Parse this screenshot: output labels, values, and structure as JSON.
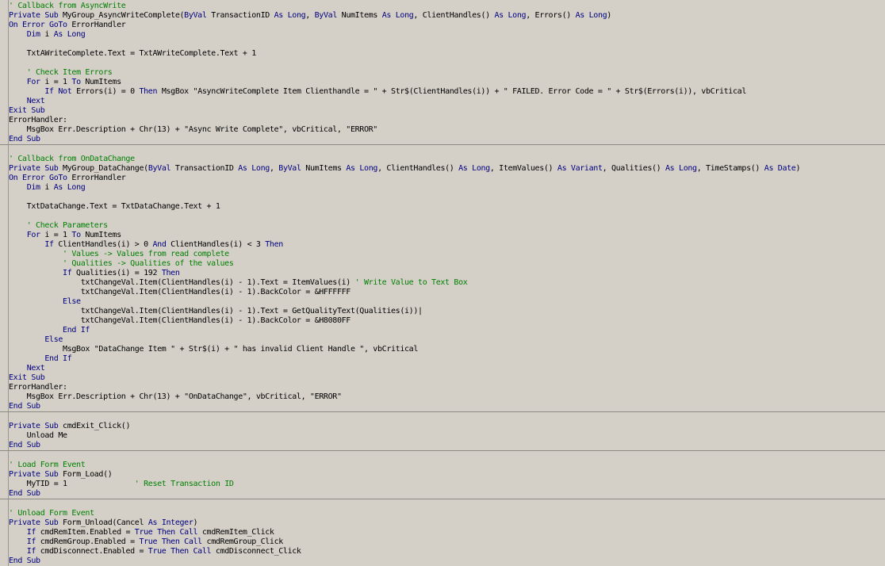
{
  "colors": {
    "keyword": "#00007f",
    "comment": "#007f00",
    "text": "#000000",
    "background": "#d4d0c8"
  },
  "lines": [
    [
      [
        "c",
        "' Callback from AsyncWrite"
      ]
    ],
    [
      [
        "k",
        "Private Sub"
      ],
      [
        "t",
        " MyGroup_AsyncWriteComplete("
      ],
      [
        "k",
        "ByVal"
      ],
      [
        "t",
        " TransactionID "
      ],
      [
        "k",
        "As Long"
      ],
      [
        "t",
        ", "
      ],
      [
        "k",
        "ByVal"
      ],
      [
        "t",
        " NumItems "
      ],
      [
        "k",
        "As Long"
      ],
      [
        "t",
        ", ClientHandles() "
      ],
      [
        "k",
        "As Long"
      ],
      [
        "t",
        ", Errors() "
      ],
      [
        "k",
        "As Long"
      ],
      [
        "t",
        ")"
      ]
    ],
    [
      [
        "k",
        "On Error GoTo"
      ],
      [
        "t",
        " ErrorHandler"
      ]
    ],
    [
      [
        "t",
        "    "
      ],
      [
        "k",
        "Dim"
      ],
      [
        "t",
        " i "
      ],
      [
        "k",
        "As Long"
      ]
    ],
    [],
    [
      [
        "t",
        "    TxtAWriteComplete.Text = TxtAWriteComplete.Text + 1"
      ]
    ],
    [],
    [
      [
        "t",
        "    "
      ],
      [
        "c",
        "' Check Item Errors"
      ]
    ],
    [
      [
        "t",
        "    "
      ],
      [
        "k",
        "For"
      ],
      [
        "t",
        " i = 1 "
      ],
      [
        "k",
        "To"
      ],
      [
        "t",
        " NumItems"
      ]
    ],
    [
      [
        "t",
        "        "
      ],
      [
        "k",
        "If Not"
      ],
      [
        "t",
        " Errors(i) = 0 "
      ],
      [
        "k",
        "Then"
      ],
      [
        "t",
        " MsgBox \"AsyncWriteComplete Item Clienthandle = \" + Str$(ClientHandles(i)) + \" FAILED. Error Code = \" + Str$(Errors(i)), vbCritical"
      ]
    ],
    [
      [
        "t",
        "    "
      ],
      [
        "k",
        "Next"
      ]
    ],
    [
      [
        "k",
        "Exit Sub"
      ]
    ],
    [
      [
        "t",
        "ErrorHandler:"
      ]
    ],
    [
      [
        "t",
        "    MsgBox Err.Description + Chr(13) + \"Async Write Complete\", vbCritical, \"ERROR\""
      ]
    ],
    [
      [
        "k",
        "End Sub"
      ]
    ],
    "sep",
    [],
    [
      [
        "c",
        "' Callback from OnDataChange"
      ]
    ],
    [
      [
        "k",
        "Private Sub"
      ],
      [
        "t",
        " MyGroup_DataChange("
      ],
      [
        "k",
        "ByVal"
      ],
      [
        "t",
        " TransactionID "
      ],
      [
        "k",
        "As Long"
      ],
      [
        "t",
        ", "
      ],
      [
        "k",
        "ByVal"
      ],
      [
        "t",
        " NumItems "
      ],
      [
        "k",
        "As Long"
      ],
      [
        "t",
        ", ClientHandles() "
      ],
      [
        "k",
        "As Long"
      ],
      [
        "t",
        ", ItemValues() "
      ],
      [
        "k",
        "As Variant"
      ],
      [
        "t",
        ", Qualities() "
      ],
      [
        "k",
        "As Long"
      ],
      [
        "t",
        ", TimeStamps() "
      ],
      [
        "k",
        "As Date"
      ],
      [
        "t",
        ")"
      ]
    ],
    [
      [
        "k",
        "On Error GoTo"
      ],
      [
        "t",
        " ErrorHandler"
      ]
    ],
    [
      [
        "t",
        "    "
      ],
      [
        "k",
        "Dim"
      ],
      [
        "t",
        " i "
      ],
      [
        "k",
        "As Long"
      ]
    ],
    [],
    [
      [
        "t",
        "    TxtDataChange.Text = TxtDataChange.Text + 1"
      ]
    ],
    [],
    [
      [
        "t",
        "    "
      ],
      [
        "c",
        "' Check Parameters"
      ]
    ],
    [
      [
        "t",
        "    "
      ],
      [
        "k",
        "For"
      ],
      [
        "t",
        " i = 1 "
      ],
      [
        "k",
        "To"
      ],
      [
        "t",
        " NumItems"
      ]
    ],
    [
      [
        "t",
        "        "
      ],
      [
        "k",
        "If"
      ],
      [
        "t",
        " ClientHandles(i) > 0 "
      ],
      [
        "k",
        "And"
      ],
      [
        "t",
        " ClientHandles(i) < 3 "
      ],
      [
        "k",
        "Then"
      ]
    ],
    [
      [
        "t",
        "            "
      ],
      [
        "c",
        "' Values -> Values from read complete"
      ]
    ],
    [
      [
        "t",
        "            "
      ],
      [
        "c",
        "' Qualities -> Qualities of the values"
      ]
    ],
    [
      [
        "t",
        "            "
      ],
      [
        "k",
        "If"
      ],
      [
        "t",
        " Qualities(i) = 192 "
      ],
      [
        "k",
        "Then"
      ]
    ],
    [
      [
        "t",
        "                txtChangeVal.Item(ClientHandles(i) - 1).Text = ItemValues(i) "
      ],
      [
        "c",
        "' Write Value to Text Box"
      ]
    ],
    [
      [
        "t",
        "                txtChangeVal.Item(ClientHandles(i) - 1).BackColor = &HFFFFFF"
      ]
    ],
    [
      [
        "t",
        "            "
      ],
      [
        "k",
        "Else"
      ]
    ],
    [
      [
        "t",
        "                txtChangeVal.Item(ClientHandles(i) - 1).Text = GetQualityText(Qualities(i))|"
      ]
    ],
    [
      [
        "t",
        "                txtChangeVal.Item(ClientHandles(i) - 1).BackColor = &H8080FF"
      ]
    ],
    [
      [
        "t",
        "            "
      ],
      [
        "k",
        "End If"
      ]
    ],
    [
      [
        "t",
        "        "
      ],
      [
        "k",
        "Else"
      ]
    ],
    [
      [
        "t",
        "            MsgBox \"DataChange Item \" + Str$(i) + \" has invalid Client Handle \", vbCritical"
      ]
    ],
    [
      [
        "t",
        "        "
      ],
      [
        "k",
        "End If"
      ]
    ],
    [
      [
        "t",
        "    "
      ],
      [
        "k",
        "Next"
      ]
    ],
    [
      [
        "k",
        "Exit Sub"
      ]
    ],
    [
      [
        "t",
        "ErrorHandler:"
      ]
    ],
    [
      [
        "t",
        "    MsgBox Err.Description + Chr(13) + \"OnDataChange\", vbCritical, \"ERROR\""
      ]
    ],
    [
      [
        "k",
        "End Sub"
      ]
    ],
    "sep",
    [],
    [
      [
        "k",
        "Private Sub"
      ],
      [
        "t",
        " cmdExit_Click()"
      ]
    ],
    [
      [
        "t",
        "    Unload Me"
      ]
    ],
    [
      [
        "k",
        "End Sub"
      ]
    ],
    "sep",
    [],
    [
      [
        "c",
        "' Load Form Event"
      ]
    ],
    [
      [
        "k",
        "Private Sub"
      ],
      [
        "t",
        " Form_Load()"
      ]
    ],
    [
      [
        "t",
        "    MyTID = 1               "
      ],
      [
        "c",
        "' Reset Transaction ID"
      ]
    ],
    [
      [
        "k",
        "End Sub"
      ]
    ],
    "sep",
    [],
    [
      [
        "c",
        "' Unload Form Event"
      ]
    ],
    [
      [
        "k",
        "Private Sub"
      ],
      [
        "t",
        " Form_Unload(Cancel "
      ],
      [
        "k",
        "As Integer"
      ],
      [
        "t",
        ")"
      ]
    ],
    [
      [
        "t",
        "    "
      ],
      [
        "k",
        "If"
      ],
      [
        "t",
        " cmdRemItem.Enabled = "
      ],
      [
        "k",
        "True Then Call"
      ],
      [
        "t",
        " cmdRemItem_Click"
      ]
    ],
    [
      [
        "t",
        "    "
      ],
      [
        "k",
        "If"
      ],
      [
        "t",
        " cmdRemGroup.Enabled = "
      ],
      [
        "k",
        "True Then Call"
      ],
      [
        "t",
        " cmdRemGroup_Click"
      ]
    ],
    [
      [
        "t",
        "    "
      ],
      [
        "k",
        "If"
      ],
      [
        "t",
        " cmdDisconnect.Enabled = "
      ],
      [
        "k",
        "True Then Call"
      ],
      [
        "t",
        " cmdDisconnect_Click"
      ]
    ],
    [
      [
        "k",
        "End Sub"
      ]
    ]
  ]
}
